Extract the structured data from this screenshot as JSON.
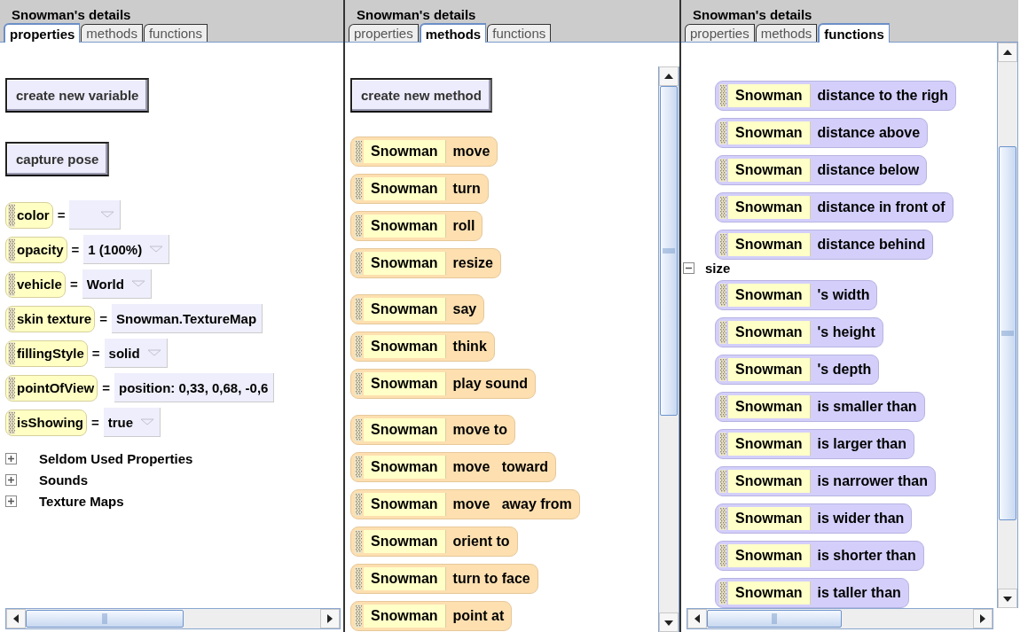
{
  "panels": [
    {
      "title": "Snowman's details",
      "tabs": [
        {
          "label": "properties",
          "selected": true
        },
        {
          "label": "methods",
          "selected": false
        },
        {
          "label": "functions",
          "selected": false
        }
      ],
      "buttons": [
        "create new variable",
        "capture pose"
      ],
      "properties": [
        {
          "name": "color",
          "operator": "=",
          "dropdown": true
        },
        {
          "name": "opacity",
          "operator": "=",
          "value": "1 (100%)",
          "dropdown": true
        },
        {
          "name": "vehicle",
          "operator": "=",
          "value": "World",
          "dropdown": true
        },
        {
          "name": "skin texture",
          "operator": "=",
          "value": "Snowman.TextureMap",
          "dropdown": false
        },
        {
          "name": "fillingStyle",
          "operator": "=",
          "value": "solid",
          "dropdown": true
        },
        {
          "name": "pointOfView",
          "operator": "=",
          "value": "position: 0,33, 0,68, -0,6",
          "dropdown": false
        },
        {
          "name": "isShowing",
          "operator": "=",
          "value": "true",
          "dropdown": true
        }
      ],
      "tree": [
        {
          "label": "Seldom Used Properties",
          "expanded": false
        },
        {
          "label": "Sounds",
          "expanded": false
        },
        {
          "label": "Texture Maps",
          "expanded": false
        }
      ]
    },
    {
      "title": "Snowman's details",
      "tabs": [
        {
          "label": "properties",
          "selected": false
        },
        {
          "label": "methods",
          "selected": true
        },
        {
          "label": "functions",
          "selected": false
        }
      ],
      "buttons": [
        "create new method"
      ],
      "tile_groups": [
        {
          "kind": "method",
          "tiles": [
            {
              "object": "Snowman",
              "action": "move"
            },
            {
              "object": "Snowman",
              "action": "turn"
            },
            {
              "object": "Snowman",
              "action": "roll"
            },
            {
              "object": "Snowman",
              "action": "resize"
            }
          ]
        },
        {
          "kind": "method",
          "tiles": [
            {
              "object": "Snowman",
              "action": "say"
            },
            {
              "object": "Snowman",
              "action": "think"
            },
            {
              "object": "Snowman",
              "action": "play sound"
            }
          ]
        },
        {
          "kind": "method",
          "tiles": [
            {
              "object": "Snowman",
              "action": "move to"
            },
            {
              "object": "Snowman",
              "action": "move   toward"
            },
            {
              "object": "Snowman",
              "action": "move   away from"
            },
            {
              "object": "Snowman",
              "action": "orient to"
            },
            {
              "object": "Snowman",
              "action": "turn to face"
            },
            {
              "object": "Snowman",
              "action": "point at"
            }
          ]
        }
      ]
    },
    {
      "title": "Snowman's details",
      "tabs": [
        {
          "label": "properties",
          "selected": false
        },
        {
          "label": "methods",
          "selected": false
        },
        {
          "label": "functions",
          "selected": true
        }
      ],
      "tile_groups": [
        {
          "kind": "function",
          "tiles": [
            {
              "object": "Snowman",
              "action": "distance to the righ"
            },
            {
              "object": "Snowman",
              "action": "distance above"
            },
            {
              "object": "Snowman",
              "action": "distance below"
            },
            {
              "object": "Snowman",
              "action": "distance in front of"
            },
            {
              "object": "Snowman",
              "action": "distance behind"
            }
          ]
        },
        {
          "label": "size",
          "expanded": true,
          "kind": "function",
          "tiles": [
            {
              "object": "Snowman",
              "action": "'s width"
            },
            {
              "object": "Snowman",
              "action": "'s height"
            },
            {
              "object": "Snowman",
              "action": "'s depth"
            },
            {
              "object": "Snowman",
              "action": "is smaller than"
            },
            {
              "object": "Snowman",
              "action": "is larger than"
            },
            {
              "object": "Snowman",
              "action": "is narrower than"
            },
            {
              "object": "Snowman",
              "action": "is wider than"
            },
            {
              "object": "Snowman",
              "action": "is shorter than"
            },
            {
              "object": "Snowman",
              "action": "is taller than"
            }
          ]
        }
      ]
    }
  ]
}
